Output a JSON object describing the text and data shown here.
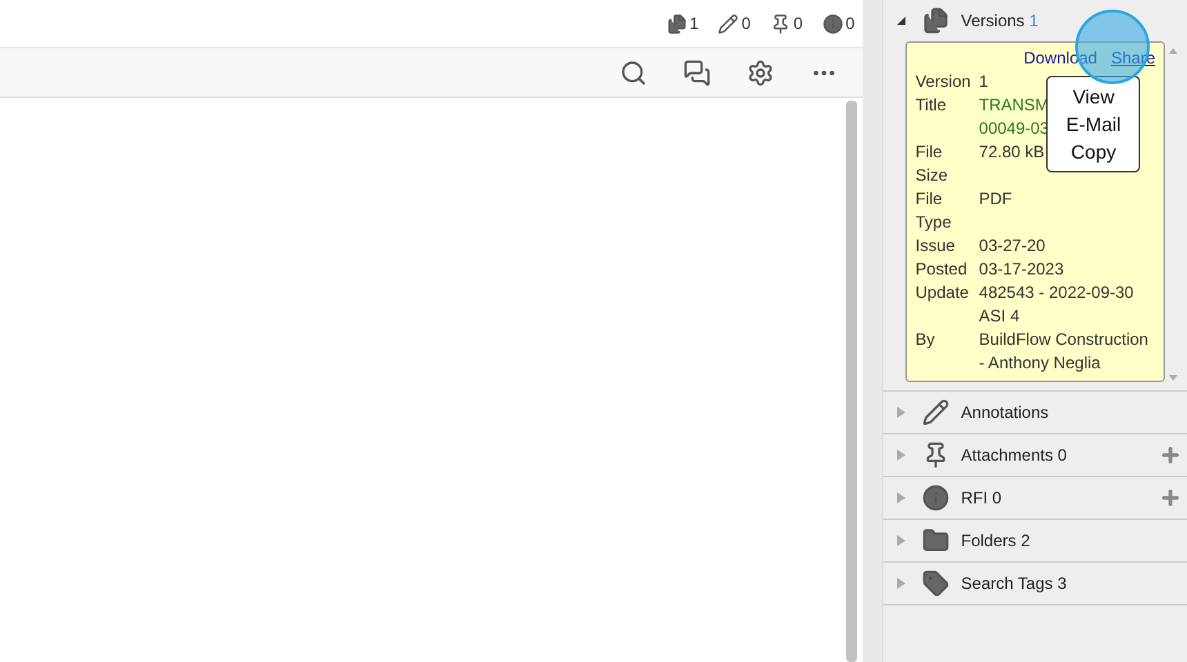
{
  "header_counts": [
    {
      "kind": "versions",
      "count": "1"
    },
    {
      "kind": "annotations",
      "count": "0"
    },
    {
      "kind": "attachments",
      "count": "0"
    },
    {
      "kind": "rfi",
      "count": "0"
    }
  ],
  "sections": [
    {
      "kind": "versions",
      "label": "Versions",
      "count": "1",
      "expanded": true,
      "add": false
    },
    {
      "kind": "annotations",
      "label": "Annotations",
      "expanded": false,
      "add": false
    },
    {
      "kind": "attachments",
      "label": "Attachments 0",
      "expanded": false,
      "add": true
    },
    {
      "kind": "rfi",
      "label": "RFI 0",
      "expanded": false,
      "add": true
    },
    {
      "kind": "folders",
      "label": "Folders 2",
      "expanded": false,
      "add": false
    },
    {
      "kind": "tags",
      "label": "Search Tags 3",
      "expanded": false,
      "add": false
    }
  ],
  "version_card": {
    "actions": [
      {
        "label": "Download",
        "underlined": false
      },
      {
        "label": "Share",
        "underlined": true
      }
    ],
    "share_menu": [
      "View",
      "E-Mail",
      "Copy"
    ],
    "fields": [
      {
        "label": "Version",
        "lines": [
          "1"
        ],
        "green": false
      },
      {
        "label": "Title",
        "lines": [
          "TRANSM",
          "00049-03"
        ],
        "green": true
      },
      {
        "label": "File Size",
        "lines": [
          "72.80 kB"
        ],
        "green": false
      },
      {
        "label": "File Type",
        "lines": [
          "PDF"
        ],
        "green": false
      },
      {
        "label": "Issue",
        "lines": [
          "03-27-20"
        ],
        "green": false
      },
      {
        "label": "Posted",
        "lines": [
          "03-17-2023"
        ],
        "green": false
      },
      {
        "label": "Update",
        "lines": [
          "482543 - 2022-09-30",
          "ASI 4"
        ],
        "green": false
      },
      {
        "label": "By",
        "lines": [
          "BuildFlow Construction",
          "- Anthony Neglia"
        ],
        "green": false
      }
    ]
  },
  "click_highlight": true
}
